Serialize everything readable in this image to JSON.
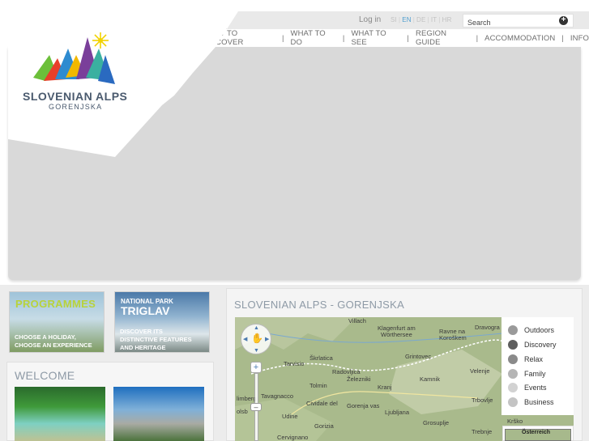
{
  "header": {
    "login_label": "Log in",
    "languages": [
      {
        "code": "SI",
        "active": false
      },
      {
        "code": "EN",
        "active": true
      },
      {
        "code": "DE",
        "active": false
      },
      {
        "code": "IT",
        "active": false
      },
      {
        "code": "HR",
        "active": false
      }
    ],
    "search_placeholder": "Search",
    "search_button_icon": "plus-circle-icon"
  },
  "nav": {
    "items": [
      "WHAT TO DISCOVER",
      "WHAT TO DO",
      "WHAT TO SEE",
      "REGION GUIDE",
      "ACCOMMODATION",
      "INFO"
    ]
  },
  "logo": {
    "title": "SLOVENIAN ALPS",
    "subtitle": "GORENJSKA"
  },
  "promos": {
    "programmes": {
      "title": "PROGRAMMES",
      "line1": "CHOOSE  A HOLIDAY,",
      "line2": "CHOOSE AN EXPERIENCE"
    },
    "triglav": {
      "kicker": "NATIONAL PARK",
      "title": "TRIGLAV",
      "line1": "DISCOVER ITS",
      "line2": "DISTINCTIVE FEATURES",
      "line3": "AND HERITAGE"
    }
  },
  "welcome": {
    "title": "WELCOME"
  },
  "map": {
    "title": "SLOVENIAN ALPS - GORENJSKA",
    "towns": {
      "villach": "Villach",
      "klagenfurt1": "Klagenfurt am",
      "klagenfurt2": "Wörthersee",
      "ravne1": "Ravne na",
      "ravne2": "Koroškem",
      "dravograd": "Dravogra",
      "skrlatica": "Škrlatica",
      "grintovec": "Grintovec",
      "radovljica": "Radovljica",
      "zelezniki": "Železniki",
      "kamnik": "Kamnik",
      "tarvisio": "Tarvisio",
      "tolmin": "Tolmin",
      "kranj": "Kranj",
      "velenje": "Velenje",
      "tavagnacco": "Tavagnacco",
      "cividale": "Cividale del",
      "gorenja_vas": "Gorenja vas",
      "ljubljana": "Ljubljana",
      "trbovlje": "Trbovlje",
      "udine": "Udine",
      "gorizia": "Gorizia",
      "grosuplje": "Grosuplje",
      "trebnje": "Trebnje",
      "krsko": "Krško",
      "cervignano": "Cervignano",
      "limberg": "limberg",
      "oldsb": "olsb"
    },
    "legend": [
      {
        "label": "Outdoors",
        "color": "#9a9a9a"
      },
      {
        "label": "Discovery",
        "color": "#5e5e5e"
      },
      {
        "label": "Relax",
        "color": "#8a8a8a"
      },
      {
        "label": "Family",
        "color": "#b5b5b5"
      },
      {
        "label": "Events",
        "color": "#d2d2d2"
      },
      {
        "label": "Business",
        "color": "#c4c4c4"
      }
    ],
    "overview_label": "Österreich"
  },
  "colors": {
    "accent_blue": "#4f9fd0",
    "programmes_green": "#b8d33a",
    "heading_gray": "#8e9aa6"
  }
}
